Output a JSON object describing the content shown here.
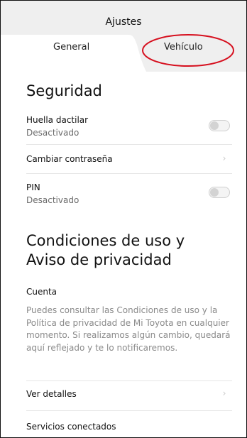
{
  "header": {
    "title": "Ajustes",
    "tabs": [
      {
        "label": "General",
        "active": true
      },
      {
        "label": "Vehículo",
        "active": false
      }
    ]
  },
  "security": {
    "heading": "Seguridad",
    "fingerprint": {
      "label": "Huella dactilar",
      "status": "Desactivado",
      "enabled": false
    },
    "change_password": {
      "label": "Cambiar contraseña"
    },
    "pin": {
      "label": "PIN",
      "status": "Desactivado",
      "enabled": false
    }
  },
  "terms": {
    "heading_line1": "Condiciones de uso y",
    "heading_line2": "Aviso de privacidad",
    "account": {
      "label": "Cuenta",
      "description": "Puedes consultar las Condiciones de uso y la Política de privacidad de Mi Toyota en cualquier momento. Si realizamos algún cambio, quedará aquí reflejado y te lo notificaremos."
    },
    "view_details": {
      "label": "Ver detalles"
    },
    "connected_services": {
      "label": "Servicios conectados"
    }
  },
  "colors": {
    "annotation": "#d60f1e",
    "header_bg": "#efefef"
  }
}
